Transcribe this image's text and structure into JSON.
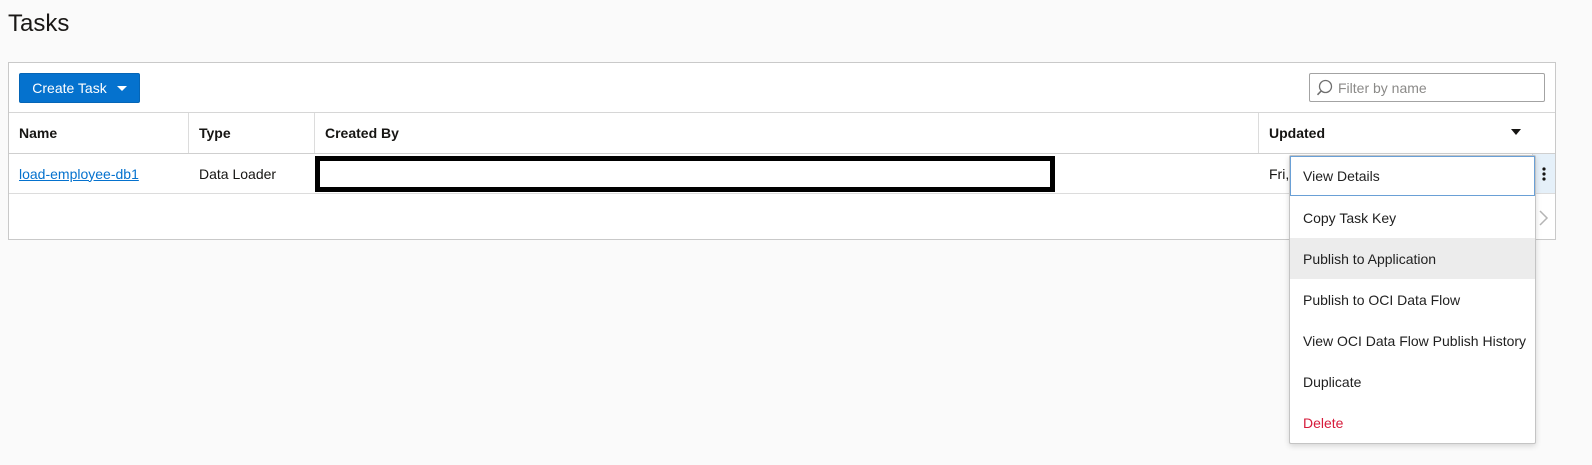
{
  "page": {
    "title": "Tasks"
  },
  "toolbar": {
    "create_label": "Create Task",
    "filter_placeholder": "Filter by name"
  },
  "table": {
    "columns": [
      "Name",
      "Type",
      "Created By",
      "Updated"
    ],
    "rows": [
      {
        "name": "load-employee-db1",
        "type": "Data Loader",
        "created_by": "",
        "updated": "Fri,"
      }
    ]
  },
  "menu": {
    "items": [
      {
        "label": "View Details",
        "state": "focused"
      },
      {
        "label": "Copy Task Key",
        "state": "normal"
      },
      {
        "label": "Publish to Application",
        "state": "hovered"
      },
      {
        "label": "Publish to OCI Data Flow",
        "state": "normal"
      },
      {
        "label": "View OCI Data Flow Publish History",
        "state": "normal"
      },
      {
        "label": "Duplicate",
        "state": "normal"
      },
      {
        "label": "Delete",
        "state": "danger"
      }
    ]
  },
  "colors": {
    "accent": "#0572ce",
    "danger": "#d61a3a",
    "hover": "#ececec"
  },
  "icons": [
    "search-icon",
    "caret-down-icon",
    "sort-caret-icon",
    "kebab-icon",
    "chevron-right-icon"
  ]
}
